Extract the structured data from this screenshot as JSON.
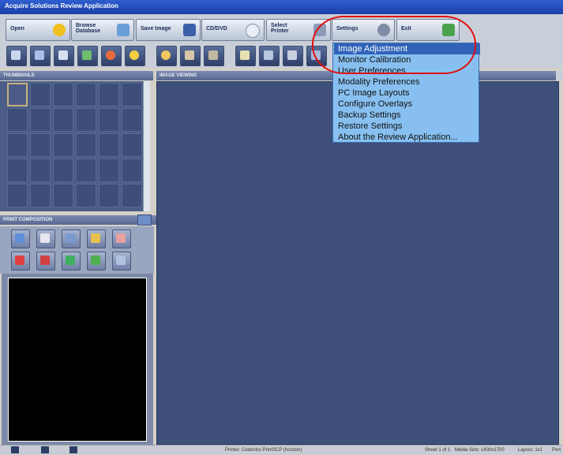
{
  "window": {
    "title": "Acquire Solutions Review Application"
  },
  "menubar": {
    "buttons": [
      {
        "label": "Open",
        "icon": "open-folder-icon"
      },
      {
        "label": "Browse\nDatabase",
        "icon": "database-icon"
      },
      {
        "label": "Save Image",
        "icon": "floppy-disk-icon"
      },
      {
        "label": "CD/DVD",
        "icon": "cd-icon"
      },
      {
        "label": "Select\nPrinter",
        "icon": "printer-icon"
      },
      {
        "label": "Settings",
        "icon": "settings-icon"
      },
      {
        "label": "Exit",
        "icon": "exit-icon"
      }
    ]
  },
  "toolbar": {
    "icons": [
      "layout-icon",
      "grid-icon",
      "split-icon",
      "cine-icon",
      "stop-icon",
      "brightness-icon",
      "zoom-icon",
      "pan-icon",
      "measure-icon",
      "annotate-icon",
      "overlay-icon",
      "compare-icon",
      "scroll-icon",
      "contrast-icon"
    ]
  },
  "panels": {
    "thumbnails_title": "THUMBNAILS",
    "image_viewing_title": "IMAGE VIEWING",
    "print_composition_title": "PRINT COMPOSITION"
  },
  "print_tools": [
    "print-icon",
    "page-icon",
    "add-icon",
    "copy-icon",
    "paste-icon",
    "delete-icon",
    "clear-icon",
    "import-icon",
    "export-icon",
    "duplicate-icon"
  ],
  "settings_menu": {
    "items": [
      "Image Adjustment",
      "Monitor Calibration",
      "User Preferences",
      "Modality Preferences",
      "PC Image Layouts",
      "Configure Overlays",
      "Backup Settings",
      "Restore Settings",
      "About the Review Application..."
    ],
    "selected_index": 0
  },
  "statusbar": {
    "printer": "Printer: Codonics PrintSCP (horizon)",
    "sheet": "Sheet 1 of 1",
    "media": "Media Size: 1400x1700",
    "layout": "Layout: 1x1",
    "orientation": "Port"
  },
  "colors": {
    "accent": "#3063b8",
    "highlight_oval": "#e01010",
    "menu_bg": "#87c0f0",
    "viewport": "#3e4f7a"
  }
}
